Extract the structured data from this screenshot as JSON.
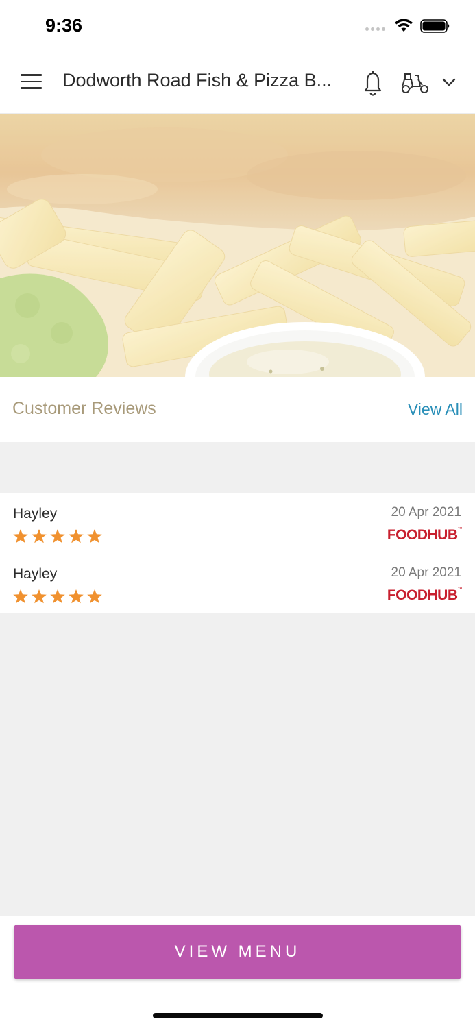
{
  "status_bar": {
    "time": "9:36",
    "icons": [
      "signal-dots-icon",
      "wifi-icon",
      "battery-icon"
    ]
  },
  "header": {
    "title": "Dodworth Road Fish & Pizza B...",
    "icons": [
      "menu-icon",
      "bell-icon",
      "scooter-icon",
      "chevron-down-icon"
    ]
  },
  "hero": {
    "description_icon": "fish-and-chips-image"
  },
  "reviews": {
    "title": "Customer Reviews",
    "view_all_label": "View All",
    "star_color": "#f0912f",
    "items": [
      {
        "name": "Hayley",
        "rating": 5,
        "date": "20 Apr 2021",
        "source": "FOODHUB"
      },
      {
        "name": "Hayley",
        "rating": 5,
        "date": "20 Apr 2021",
        "source": "FOODHUB"
      }
    ]
  },
  "footer": {
    "button_label": "VIEW MENU",
    "button_color": "#bb57ad"
  },
  "colors": {
    "accent_link": "#2a8fb8",
    "section_title": "#a89a7a",
    "brand_red": "#c8202f",
    "background": "#f0f0f0"
  }
}
